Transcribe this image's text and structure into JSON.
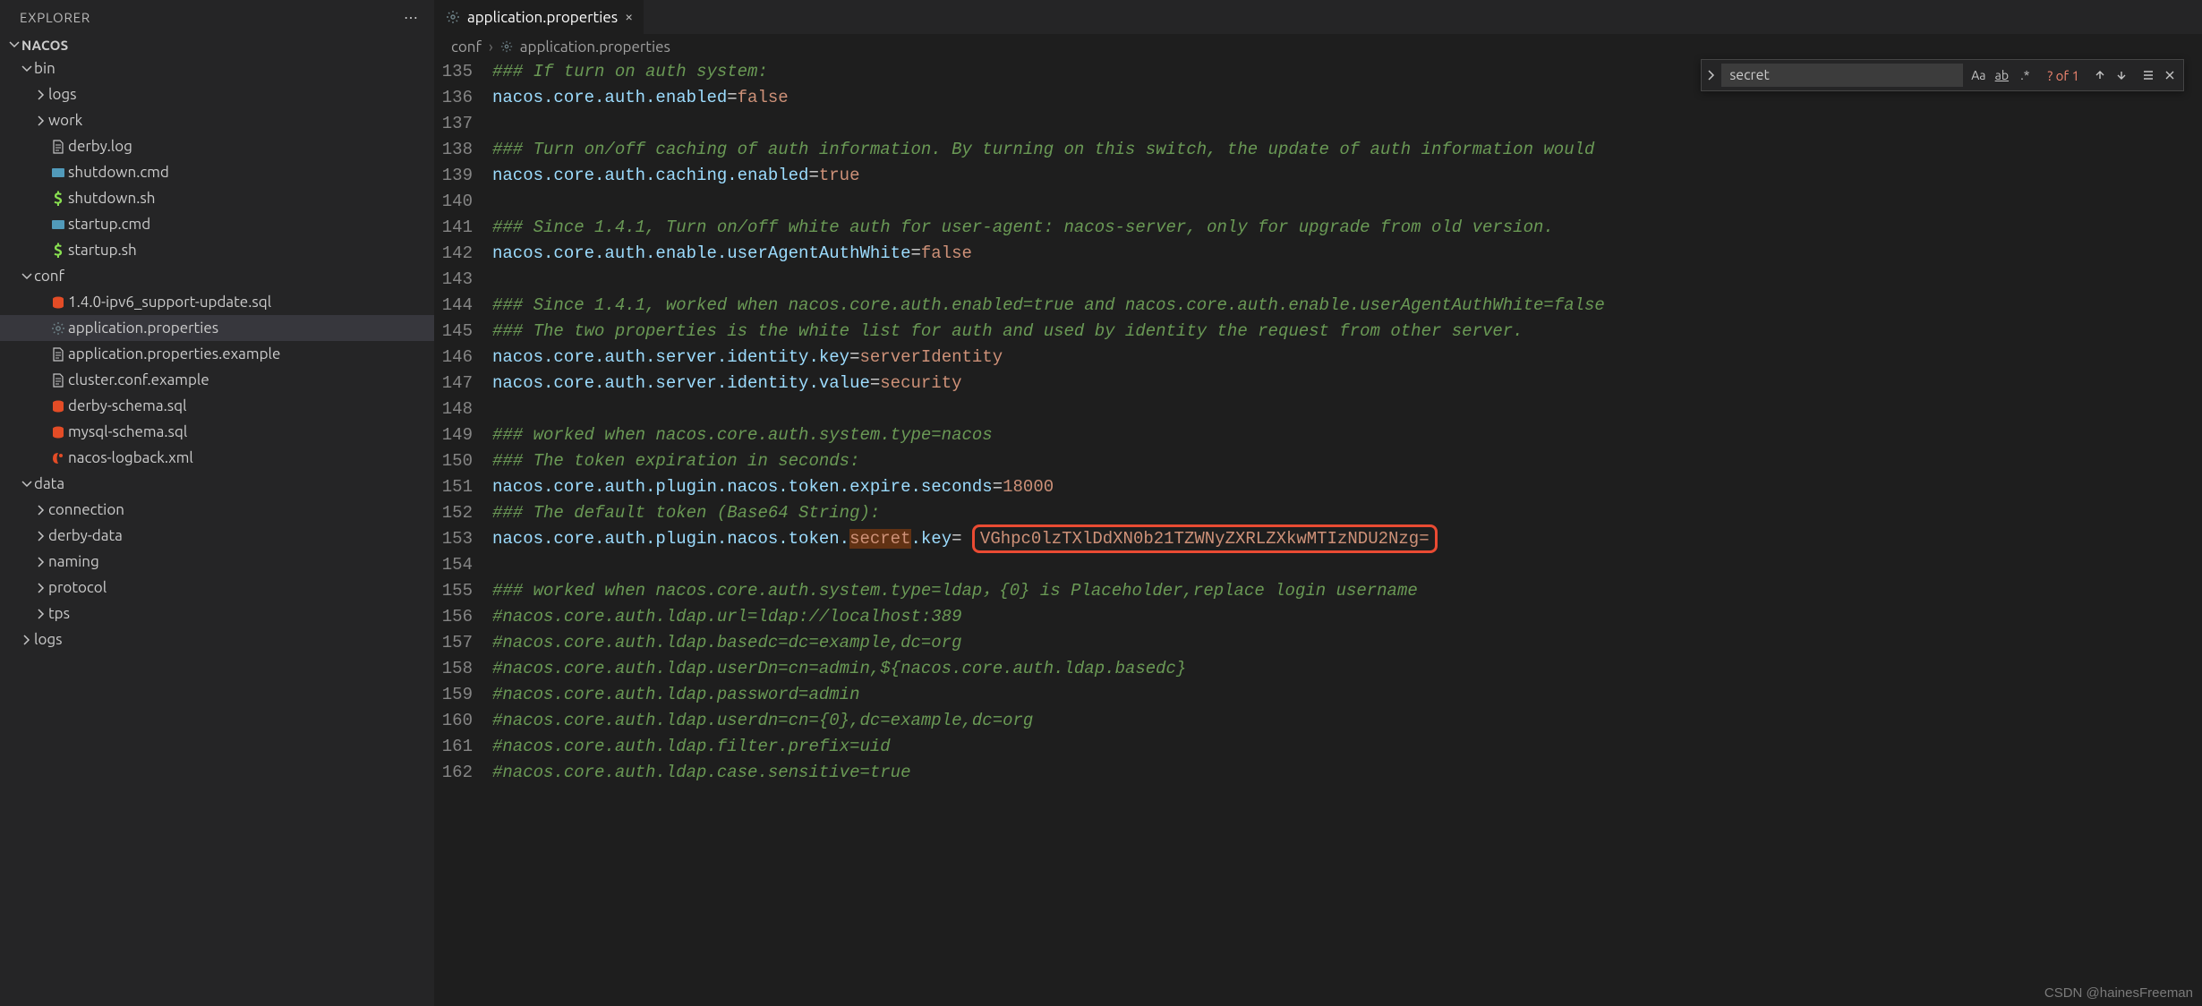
{
  "explorer": {
    "title": "EXPLORER",
    "project": "NACOS",
    "tree": [
      {
        "type": "folder",
        "depth": 0,
        "open": true,
        "label": "bin",
        "icon": "folder"
      },
      {
        "type": "folder",
        "depth": 1,
        "open": false,
        "label": "logs",
        "icon": "folder"
      },
      {
        "type": "folder",
        "depth": 1,
        "open": false,
        "label": "work",
        "icon": "folder"
      },
      {
        "type": "file",
        "depth": 1,
        "label": "derby.log",
        "icon": "file-txt"
      },
      {
        "type": "file",
        "depth": 1,
        "label": "shutdown.cmd",
        "icon": "file-cmd"
      },
      {
        "type": "file",
        "depth": 1,
        "label": "shutdown.sh",
        "icon": "file-sh"
      },
      {
        "type": "file",
        "depth": 1,
        "label": "startup.cmd",
        "icon": "file-cmd"
      },
      {
        "type": "file",
        "depth": 1,
        "label": "startup.sh",
        "icon": "file-sh"
      },
      {
        "type": "folder",
        "depth": 0,
        "open": true,
        "label": "conf",
        "icon": "folder"
      },
      {
        "type": "file",
        "depth": 1,
        "label": "1.4.0-ipv6_support-update.sql",
        "icon": "file-sql"
      },
      {
        "type": "file",
        "depth": 1,
        "label": "application.properties",
        "icon": "file-cfg",
        "active": true
      },
      {
        "type": "file",
        "depth": 1,
        "label": "application.properties.example",
        "icon": "file-txt"
      },
      {
        "type": "file",
        "depth": 1,
        "label": "cluster.conf.example",
        "icon": "file-txt"
      },
      {
        "type": "file",
        "depth": 1,
        "label": "derby-schema.sql",
        "icon": "file-sql"
      },
      {
        "type": "file",
        "depth": 1,
        "label": "mysql-schema.sql",
        "icon": "file-sql"
      },
      {
        "type": "file",
        "depth": 1,
        "label": "nacos-logback.xml",
        "icon": "file-xml"
      },
      {
        "type": "folder",
        "depth": 0,
        "open": true,
        "label": "data",
        "icon": "folder"
      },
      {
        "type": "folder",
        "depth": 1,
        "open": false,
        "label": "connection",
        "icon": "folder"
      },
      {
        "type": "folder",
        "depth": 1,
        "open": false,
        "label": "derby-data",
        "icon": "folder"
      },
      {
        "type": "folder",
        "depth": 1,
        "open": false,
        "label": "naming",
        "icon": "folder"
      },
      {
        "type": "folder",
        "depth": 1,
        "open": false,
        "label": "protocol",
        "icon": "folder"
      },
      {
        "type": "folder",
        "depth": 1,
        "open": false,
        "label": "tps",
        "icon": "folder"
      },
      {
        "type": "folder",
        "depth": 0,
        "open": false,
        "label": "logs",
        "icon": "folder"
      }
    ]
  },
  "tabs": [
    {
      "label": "application.properties",
      "active": true
    }
  ],
  "breadcrumbs": [
    "conf",
    "application.properties"
  ],
  "find": {
    "value": "secret",
    "count": "? of 1"
  },
  "code": {
    "first_line": 135,
    "lines": [
      {
        "n": 135,
        "t": "cmt",
        "text": "### If turn on auth system:"
      },
      {
        "n": 136,
        "t": "kv",
        "key": "nacos.core.auth.enabled",
        "val": "false"
      },
      {
        "n": 137,
        "t": "blank"
      },
      {
        "n": 138,
        "t": "cmt",
        "text": "### Turn on/off caching of auth information. By turning on this switch, the update of auth information would"
      },
      {
        "n": 139,
        "t": "kv",
        "key": "nacos.core.auth.caching.enabled",
        "val": "true"
      },
      {
        "n": 140,
        "t": "blank"
      },
      {
        "n": 141,
        "t": "cmt",
        "text": "### Since 1.4.1, Turn on/off white auth for user-agent: nacos-server, only for upgrade from old version."
      },
      {
        "n": 142,
        "t": "kv",
        "key": "nacos.core.auth.enable.userAgentAuthWhite",
        "val": "false"
      },
      {
        "n": 143,
        "t": "blank"
      },
      {
        "n": 144,
        "t": "cmt",
        "text": "### Since 1.4.1, worked when nacos.core.auth.enabled=true and nacos.core.auth.enable.userAgentAuthWhite=false"
      },
      {
        "n": 145,
        "t": "cmt",
        "text": "### The two properties is the white list for auth and used by identity the request from other server."
      },
      {
        "n": 146,
        "t": "kv",
        "key": "nacos.core.auth.server.identity.key",
        "val": "serverIdentity"
      },
      {
        "n": 147,
        "t": "kv",
        "key": "nacos.core.auth.server.identity.value",
        "val": "security"
      },
      {
        "n": 148,
        "t": "blank"
      },
      {
        "n": 149,
        "t": "cmt",
        "text": "### worked when nacos.core.auth.system.type=nacos"
      },
      {
        "n": 150,
        "t": "cmt",
        "text": "### The token expiration in seconds:"
      },
      {
        "n": 151,
        "t": "kv",
        "key": "nacos.core.auth.plugin.nacos.token.expire.seconds",
        "val": "18000"
      },
      {
        "n": 152,
        "t": "cmt",
        "text": "### The default token (Base64 String):"
      },
      {
        "n": 153,
        "t": "secret",
        "key_pre": "nacos.core.auth.plugin.nacos.token.",
        "hl": "secret",
        "key_post": ".key",
        "boxed": "VGhpc0lzTXlDdXN0b21TZWNyZXRLZXkwMTIzNDU2Nzg="
      },
      {
        "n": 154,
        "t": "blank"
      },
      {
        "n": 155,
        "t": "cmt",
        "text": "### worked when nacos.core.auth.system.type=ldap，{0} is Placeholder,replace login username"
      },
      {
        "n": 156,
        "t": "cmt",
        "text": "#nacos.core.auth.ldap.url=ldap://localhost:389"
      },
      {
        "n": 157,
        "t": "cmt",
        "text": "#nacos.core.auth.ldap.basedc=dc=example,dc=org"
      },
      {
        "n": 158,
        "t": "cmt",
        "text": "#nacos.core.auth.ldap.userDn=cn=admin,${nacos.core.auth.ldap.basedc}"
      },
      {
        "n": 159,
        "t": "cmt",
        "text": "#nacos.core.auth.ldap.password=admin"
      },
      {
        "n": 160,
        "t": "cmt",
        "text": "#nacos.core.auth.ldap.userdn=cn={0},dc=example,dc=org"
      },
      {
        "n": 161,
        "t": "cmt",
        "text": "#nacos.core.auth.ldap.filter.prefix=uid"
      },
      {
        "n": 162,
        "t": "cmt",
        "text": "#nacos.core.auth.ldap.case.sensitive=true"
      }
    ]
  },
  "watermark": "CSDN @hainesFreeman"
}
